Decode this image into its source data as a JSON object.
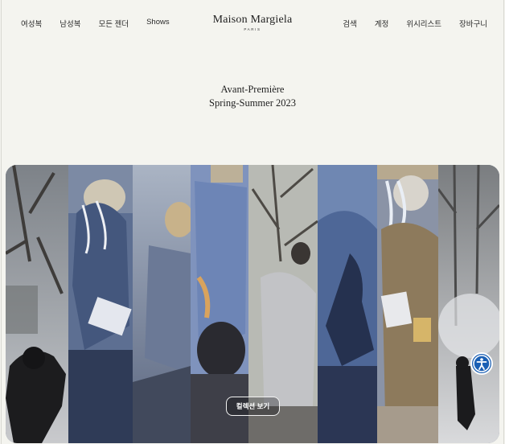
{
  "nav": {
    "left": [
      "여성복",
      "남성복",
      "모든 젠더",
      "Shows"
    ],
    "right": [
      "검색",
      "계정",
      "위시리스트",
      "장바구니"
    ]
  },
  "logo": {
    "main": "Maison Margiela",
    "sub": "PARIS"
  },
  "headline": {
    "line1": "Avant-Première",
    "line2": "Spring-Summer 2023"
  },
  "hero": {
    "cta_label": "컬렉션 보기"
  },
  "icons": {
    "accessibility": "accessibility-icon"
  },
  "colors": {
    "background": "#f4f4ef",
    "accessibility_button": "#1a5fb4"
  }
}
